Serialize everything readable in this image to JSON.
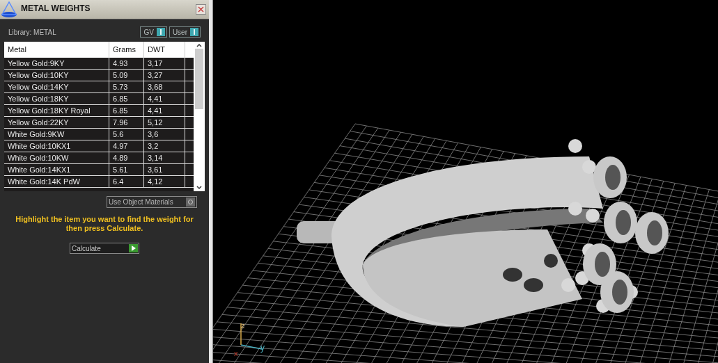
{
  "panel": {
    "title": "METAL WEIGHTS",
    "library_label": "Library: METAL",
    "toggles": [
      {
        "label": "GV",
        "on": true
      },
      {
        "label": "User",
        "on": true
      }
    ],
    "table": {
      "columns": [
        "Metal",
        "Grams",
        "DWT"
      ],
      "rows": [
        {
          "metal": "Yellow Gold:9KY",
          "grams": "4.93",
          "dwt": "3,17"
        },
        {
          "metal": "Yellow Gold:10KY",
          "grams": "5.09",
          "dwt": "3,27"
        },
        {
          "metal": "Yellow Gold:14KY",
          "grams": "5.73",
          "dwt": "3,68"
        },
        {
          "metal": "Yellow Gold:18KY",
          "grams": "6.85",
          "dwt": "4,41"
        },
        {
          "metal": "Yellow Gold:18KY Royal",
          "grams": "6.85",
          "dwt": "4,41"
        },
        {
          "metal": "Yellow Gold:22KY",
          "grams": "7.96",
          "dwt": "5,12"
        },
        {
          "metal": "White Gold:9KW",
          "grams": "5.6",
          "dwt": "3,6"
        },
        {
          "metal": "White Gold:10KX1",
          "grams": "4.97",
          "dwt": "3,2"
        },
        {
          "metal": "White Gold:10KW",
          "grams": "4.89",
          "dwt": "3,14"
        },
        {
          "metal": "White Gold:14KX1",
          "grams": "5.61",
          "dwt": "3,61"
        },
        {
          "metal": "White Gold:14K PdW",
          "grams": "6.4",
          "dwt": "4,12"
        }
      ]
    },
    "use_object_materials": {
      "label": "Use Object Materials",
      "on": false
    },
    "hint": "Highlight the item you want to find the weight for then press Calculate.",
    "calculate_button": "Calculate"
  },
  "viewport": {
    "axes": {
      "z": "z",
      "y": "y",
      "x": "x"
    }
  }
}
